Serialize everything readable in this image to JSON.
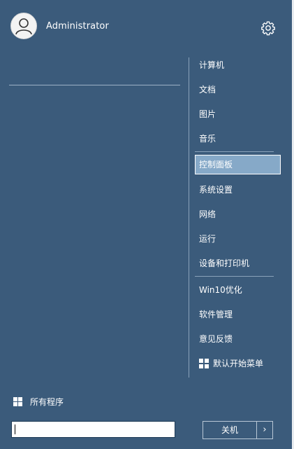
{
  "user": {
    "name": "Administrator",
    "avatar_icon": "user-silhouette-icon"
  },
  "settings_icon": "gear-icon",
  "right_column": {
    "group1": [
      "计算机",
      "文档",
      "图片",
      "音乐"
    ],
    "group2": [
      "控制面板",
      "系统设置",
      "网络",
      "运行",
      "设备和打印机"
    ],
    "group3": [
      "Win10优化",
      "软件管理",
      "意见反馈",
      "默认开始菜单"
    ],
    "active_item": "控制面板"
  },
  "all_programs": {
    "label": "所有程序",
    "icon": "grid-icon"
  },
  "search": {
    "value": "",
    "placeholder": ""
  },
  "shutdown": {
    "label": "关机",
    "arrow": "›"
  },
  "colors": {
    "background": "#3b5b7b",
    "highlight": "#86a9c8",
    "text": "#ffffff"
  }
}
